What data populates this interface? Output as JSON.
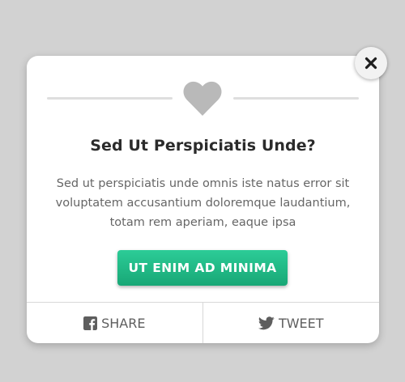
{
  "modal": {
    "title": "Sed Ut Perspiciatis Unde?",
    "body": "Sed ut perspiciatis unde omnis iste natus error sit voluptatem accusantium doloremque laudantium, totam rem aperiam, eaque ipsa",
    "cta_label": "UT ENIM AD MINIMA",
    "share_label": "SHARE",
    "tweet_label": "TWEET"
  },
  "icons": {
    "close": "close-icon",
    "heart": "heart-icon",
    "facebook": "facebook-icon",
    "twitter": "twitter-icon"
  },
  "colors": {
    "cta_top": "#2ccc97",
    "cta_bottom": "#18a776",
    "icon_gray": "#b9b9b9",
    "backdrop": "#d2d2d2"
  }
}
